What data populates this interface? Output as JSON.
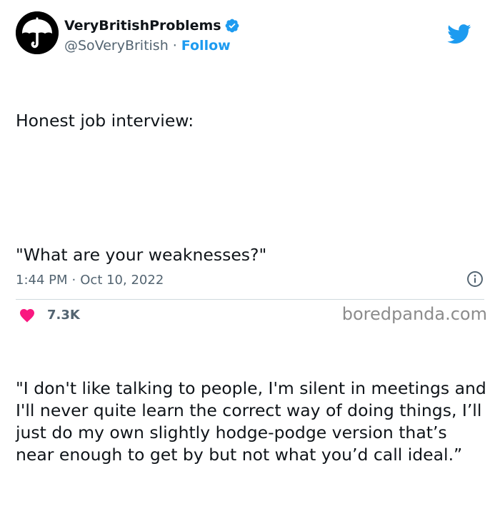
{
  "author": {
    "display_name": "VeryBritishProblems",
    "handle": "@SoVeryBritish",
    "separator": "·",
    "follow_label": "Follow",
    "verified_icon": "verified-badge-icon",
    "avatar_icon": "umbrella-icon"
  },
  "brand": {
    "logo_icon": "twitter-bird-icon",
    "accent": "#1d9bf0"
  },
  "tweet": {
    "lines": [
      "Honest job interview:",
      "\"What are your weaknesses?\"",
      "\"I don't like talking to people, I'm silent in meetings and I'll never quite learn the correct way of doing things, I’ll just do my own slightly hodge-podge version that’s near enough to get by but not what you’d call ideal.”"
    ],
    "time": "1:44 PM",
    "separator": "·",
    "date": "Oct 10, 2022",
    "info_icon": "info-icon"
  },
  "engagement": {
    "like_icon": "heart-icon",
    "like_color": "#f91880",
    "likes": "7.3K"
  },
  "watermark": {
    "text": "boredpanda.com"
  },
  "colors": {
    "text": "#0f1419",
    "secondary": "#536471",
    "divider": "#cfd9de"
  }
}
